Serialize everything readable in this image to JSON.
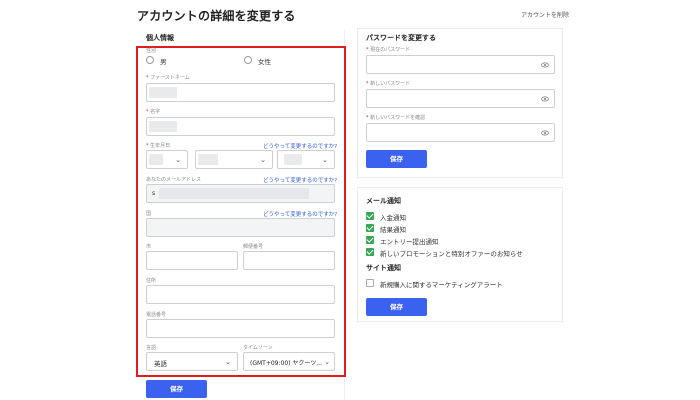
{
  "page": {
    "title": "アカウントの詳細を変更する",
    "delete_account": "アカウントを削除"
  },
  "personal": {
    "section_title": "個人情報",
    "gender": {
      "label": "性別",
      "options": [
        "男",
        "女性"
      ]
    },
    "first_name": {
      "label": "ファーストネーム",
      "required": "*"
    },
    "last_name": {
      "label": "名字",
      "required": "*"
    },
    "birthdate": {
      "label": "生年月日",
      "required": "*",
      "help_link": "どうやって変更するのですか?"
    },
    "email": {
      "label": "あなたのメールアドレス",
      "help_link": "どうやって変更するのですか?",
      "value_prefix": "s"
    },
    "country": {
      "label": "国",
      "help_link": "どうやって変更するのですか?"
    },
    "city": {
      "label": "市"
    },
    "postal_code": {
      "label": "郵便番号"
    },
    "address": {
      "label": "住所"
    },
    "phone": {
      "label": "電話番号"
    },
    "language": {
      "label": "言語",
      "value": "英語"
    },
    "timezone": {
      "label": "タイムゾーン",
      "value": "(GMT+09:00) ヤクーツ..."
    },
    "save_label": "保存"
  },
  "password": {
    "section_title": "パスワードを変更する",
    "current": {
      "label": "現在のパスワード",
      "required": "*"
    },
    "new": {
      "label": "新しいパスワード",
      "required": "*"
    },
    "confirm": {
      "label": "新しいパスワードを確認",
      "required": "*"
    },
    "save_label": "保存"
  },
  "notifications": {
    "email_title": "メール通知",
    "email_items": [
      {
        "label": "入金通知",
        "checked": true
      },
      {
        "label": "結果通知",
        "checked": true
      },
      {
        "label": "エントリー提出通知",
        "checked": true
      },
      {
        "label": "新しいプロモーションと特別オファーのお知らせ",
        "checked": true
      }
    ],
    "site_title": "サイト通知",
    "site_items": [
      {
        "label": "新規購入に関するマーケティングアラート",
        "checked": false
      }
    ],
    "save_label": "保存"
  },
  "colors": {
    "accent": "#3b62ee",
    "highlight_frame": "#e01d1d",
    "checkbox_on": "#34a853",
    "link": "#2b5bd7"
  }
}
